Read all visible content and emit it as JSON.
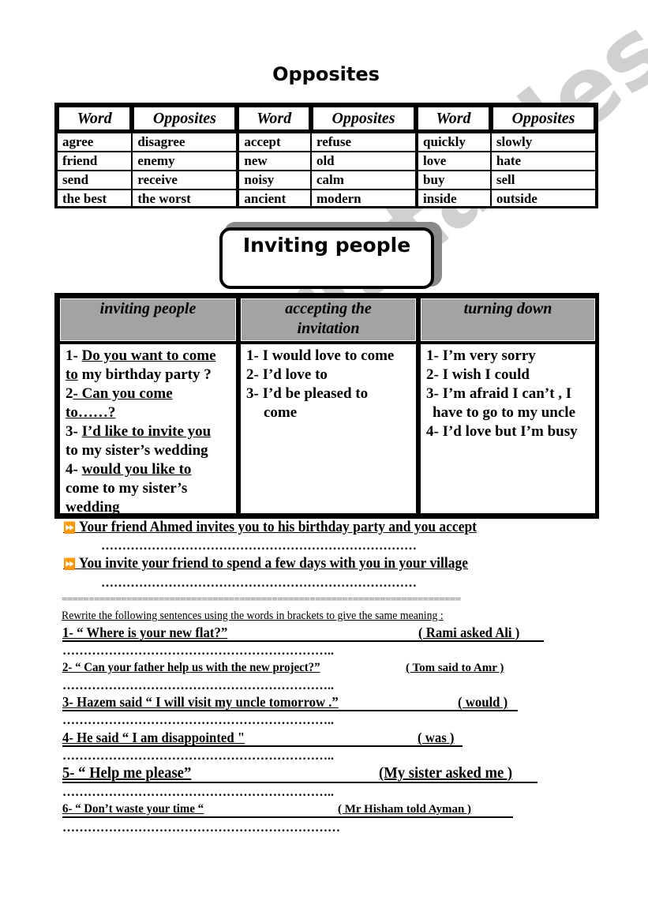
{
  "title": "Opposites",
  "opposites": {
    "headers": [
      "Word",
      "Opposites",
      "Word",
      "Opposites",
      "Word",
      "Opposites"
    ],
    "rows": [
      [
        "agree",
        "disagree",
        "accept",
        "refuse",
        "quickly",
        "slowly"
      ],
      [
        "friend",
        "enemy",
        "new",
        "old",
        "love",
        "hate"
      ],
      [
        "send",
        "receive",
        "noisy",
        "calm",
        "buy",
        "sell"
      ],
      [
        "the best",
        "the worst",
        "ancient",
        "modern",
        "inside",
        "outside"
      ]
    ]
  },
  "section_title": "Inviting people",
  "inviting_table": {
    "headers": {
      "inviting": "inviting people",
      "accepting_1": "accepting the",
      "accepting_2": "invitation",
      "turning": "turning down"
    },
    "inviting": {
      "i1_num": "1- ",
      "i1_u": "Do you want to come",
      "i1_l2u": "to",
      "i1_l2": " my birthday party ?",
      "i2_num": "2",
      "i2_u": "- Can you come",
      "i2_l2u": "to……?",
      "i3_num": "3- ",
      "i3_u": "I’d like to invite you",
      "i3_l2": "to my sister’s wedding",
      "i4_num": "4- ",
      "i4_u": "would you like to",
      "i4_l2": "come to my sister’s",
      "i4_l3": "wedding"
    },
    "accepting": [
      "1- I would love to come",
      "2- I’d love to",
      "3- I’d be pleased to",
      "come"
    ],
    "turning": [
      "1- I’m very sorry",
      "2- I wish I could",
      "3- I’m afraid I can’t , I",
      "have to go to my uncle",
      "4- I’d love but I’m busy"
    ]
  },
  "tasks": [
    {
      "icon": "⏩",
      "text": "Your friend Ahmed invites you to his birthday party and you accept",
      "answer": "…………………………………………………………………"
    },
    {
      "icon": "⏩",
      "text": "You invite your friend to spend a few days with you in your village",
      "answer": "…………………………………………………………………"
    }
  ],
  "separator": "==========================================================================",
  "instruction": "Rewrite the following sentences using the words in brackets to give the same meaning :",
  "questions": [
    {
      "text": "1- “ Where is your new flat?”",
      "hint": "( Rami asked Ali )",
      "answer": "……………………………………………………….."
    },
    {
      "text": "2- “ Can your father help us with the new project?”",
      "hint": "( Tom said to Amr )",
      "answer": "……………………………………………………….."
    },
    {
      "text": "3- Hazem said “ I will visit my uncle tomorrow .”",
      "hint": "( would )",
      "answer": "……………………………………………………….."
    },
    {
      "text": "4- He said “ I am disappointed \"",
      "hint": "( was )",
      "answer": "……………………………………………………….."
    },
    {
      "text": "5- “ Help me please”",
      "hint": "(My sister asked me )",
      "answer": "……………………………………………………….."
    },
    {
      "text": "6- “ Don’t waste your time “",
      "hint": "( Mr Hisham told Ayman )",
      "answer": "…………………………………………………………"
    }
  ],
  "watermark": "ESLprintables.com"
}
